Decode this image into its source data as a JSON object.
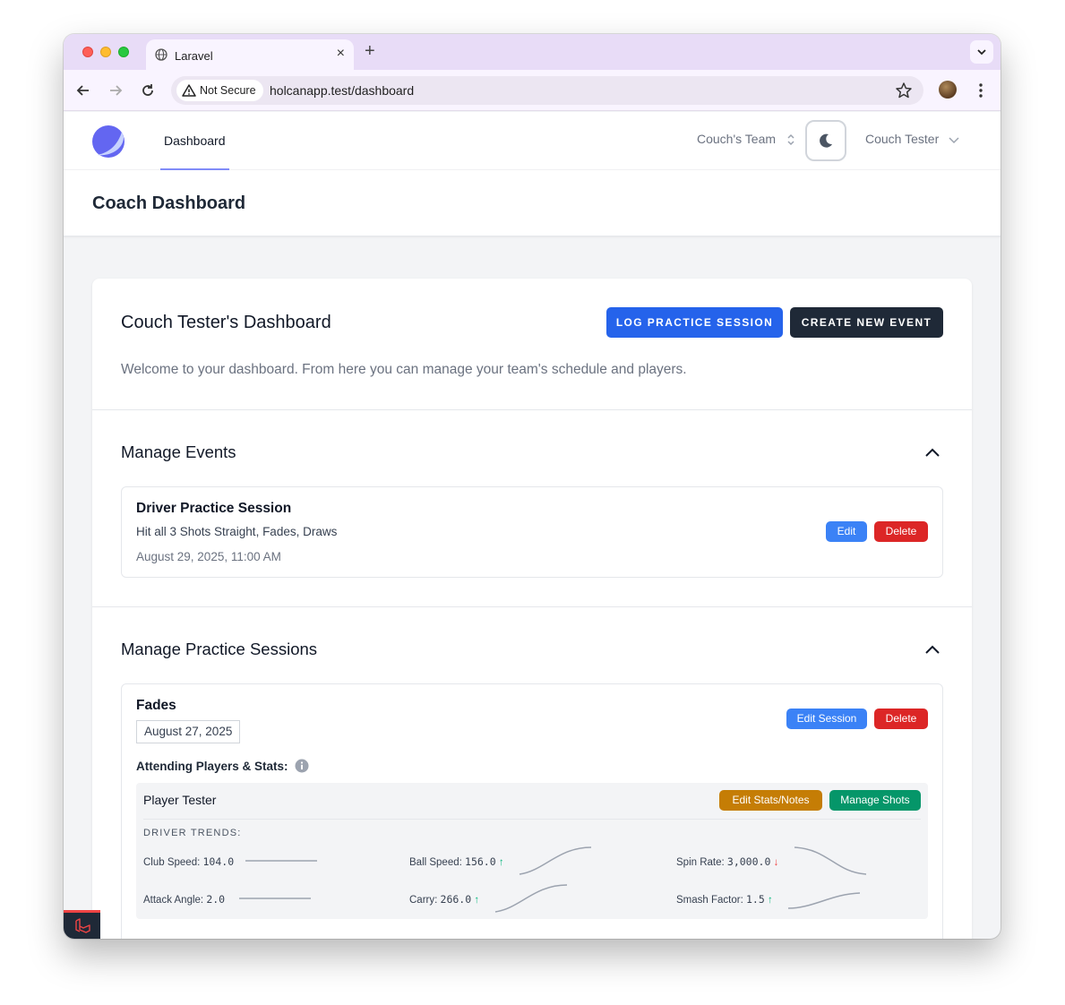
{
  "browser": {
    "tab_title": "Laravel",
    "security_label": "Not Secure",
    "url": "holcanapp.test/dashboard"
  },
  "nav": {
    "dashboard_link": "Dashboard",
    "team_name": "Couch's Team",
    "user_name": "Couch Tester"
  },
  "header": {
    "page_title": "Coach Dashboard"
  },
  "dashboard": {
    "title": "Couch Tester's Dashboard",
    "log_practice_button": "LOG PRACTICE SESSION",
    "create_event_button": "CREATE NEW EVENT",
    "welcome": "Welcome to your dashboard. From here you can manage your team's schedule and players."
  },
  "events": {
    "section_title": "Manage Events",
    "items": [
      {
        "name": "Driver Practice Session",
        "description": "Hit all 3 Shots Straight, Fades, Draws",
        "date": "August 29, 2025, 11:00 AM",
        "edit_label": "Edit",
        "delete_label": "Delete"
      }
    ]
  },
  "sessions": {
    "section_title": "Manage Practice Sessions",
    "items": [
      {
        "name": "Fades",
        "date": "August 27, 2025",
        "edit_label": "Edit Session",
        "delete_label": "Delete",
        "attending_label": "Attending Players & Stats:",
        "players": [
          {
            "name": "Player Tester",
            "edit_stats_label": "Edit Stats/Notes",
            "manage_shots_label": "Manage Shots",
            "trends_title": "DRIVER TRENDS:",
            "stats": [
              {
                "label": "Club Speed:",
                "value": "104.0",
                "trend": "flat"
              },
              {
                "label": "Ball Speed:",
                "value": "156.0",
                "trend": "up",
                "arrow": "↑"
              },
              {
                "label": "Spin Rate:",
                "value": "3,000.0",
                "trend": "down",
                "arrow": "↓"
              },
              {
                "label": "Attack Angle:",
                "value": "2.0",
                "trend": "flat"
              },
              {
                "label": "Carry:",
                "value": "266.0",
                "trend": "up",
                "arrow": "↑"
              },
              {
                "label": "Smash Factor:",
                "value": "1.5",
                "trend": "up",
                "arrow": "↑"
              }
            ]
          }
        ]
      }
    ]
  },
  "colors": {
    "primary": "#2563eb",
    "dark": "#1f2937",
    "danger": "#dc2626",
    "edit": "#3b82f6",
    "warning": "#c57d05",
    "success": "#059669",
    "nav_indicator": "#818cf8"
  },
  "icons": {
    "logo": "app-logo-icon",
    "theme_toggle": "moon-icon",
    "info": "info-icon",
    "collapse": "chevron-up-icon"
  }
}
